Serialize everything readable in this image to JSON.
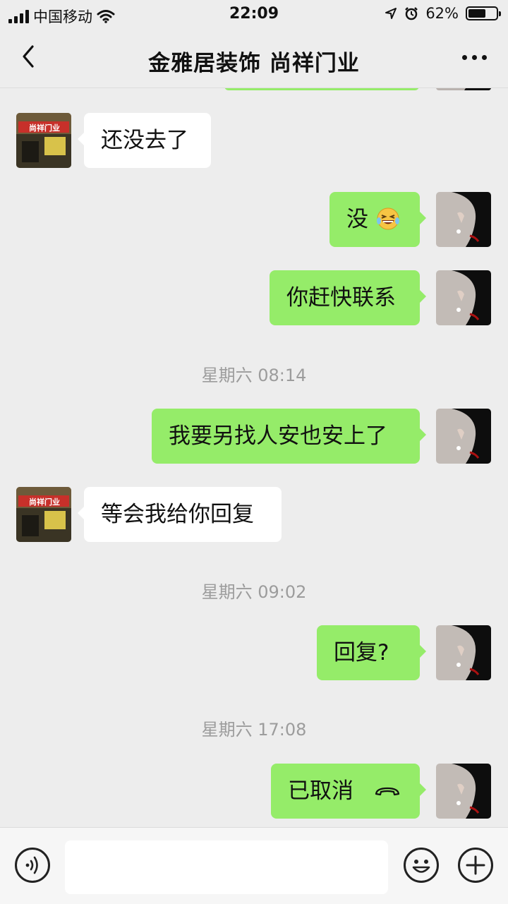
{
  "status_bar": {
    "carrier": "中国移动",
    "time": "22:09",
    "battery_percent": "62%",
    "battery_level": 0.62
  },
  "header": {
    "title": "金雅居装饰  尚祥门业"
  },
  "shop_sign_text": "尚祥门业",
  "messages": [
    {
      "text": "还没去了"
    },
    {
      "text": "没"
    },
    {
      "text": "你赶快联系"
    },
    {
      "timestamp": "星期六 08:14"
    },
    {
      "text": "我要另找人安也安上了"
    },
    {
      "text": "等会我给你回复"
    },
    {
      "timestamp": "星期六 09:02"
    },
    {
      "text": "回复?"
    },
    {
      "timestamp": "星期六 17:08"
    },
    {
      "text": "已取消"
    }
  ],
  "input_bar": {
    "message_value": ""
  },
  "icons": {
    "back": "chevron-left-icon",
    "more": "more-icon",
    "voice": "voice-icon",
    "emoji": "emoji-icon",
    "add": "add-icon",
    "call": "phone-hangup-icon",
    "emoji_in_message": "laughing-tears-emoji"
  },
  "colors": {
    "outgoing_bubble": "#95ec69",
    "incoming_bubble": "#ffffff",
    "background": "#ededed"
  }
}
